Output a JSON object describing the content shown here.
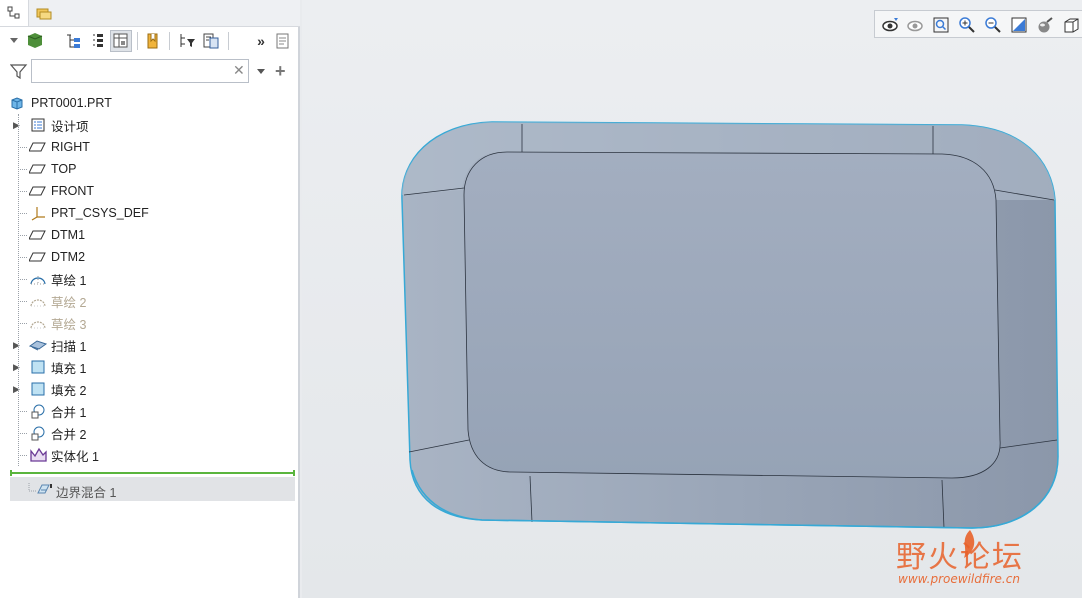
{
  "tree": {
    "root": "PRT0001.PRT",
    "items": [
      {
        "label": "设计项",
        "icon": "layers-icon",
        "expandable": true,
        "dim": false
      },
      {
        "label": "RIGHT",
        "icon": "datum-plane-icon",
        "expandable": false,
        "dim": false
      },
      {
        "label": "TOP",
        "icon": "datum-plane-icon",
        "expandable": false,
        "dim": false
      },
      {
        "label": "FRONT",
        "icon": "datum-plane-icon",
        "expandable": false,
        "dim": false
      },
      {
        "label": "PRT_CSYS_DEF",
        "icon": "csys-icon",
        "expandable": false,
        "dim": false
      },
      {
        "label": "DTM1",
        "icon": "datum-plane-icon",
        "expandable": false,
        "dim": false
      },
      {
        "label": "DTM2",
        "icon": "datum-plane-icon",
        "expandable": false,
        "dim": false
      },
      {
        "label": "草绘 1",
        "icon": "sketch-icon",
        "expandable": false,
        "dim": false
      },
      {
        "label": "草绘 2",
        "icon": "sketch-icon",
        "expandable": false,
        "dim": true
      },
      {
        "label": "草绘 3",
        "icon": "sketch-icon",
        "expandable": false,
        "dim": true
      },
      {
        "label": "扫描 1",
        "icon": "sweep-icon",
        "expandable": true,
        "dim": false
      },
      {
        "label": "填充 1",
        "icon": "fill-icon",
        "expandable": true,
        "dim": false
      },
      {
        "label": "填充 2",
        "icon": "fill-icon",
        "expandable": true,
        "dim": false
      },
      {
        "label": "合并 1",
        "icon": "merge-icon",
        "expandable": false,
        "dim": false
      },
      {
        "label": "合并 2",
        "icon": "merge-icon",
        "expandable": false,
        "dim": false
      },
      {
        "label": "实体化 1",
        "icon": "solidify-icon",
        "expandable": false,
        "dim": false
      }
    ],
    "suppressed": "边界混合 1"
  },
  "filter": {
    "value": "",
    "placeholder": ""
  },
  "watermark": {
    "title": "野火论坛",
    "url": "www.proewildfire.cn"
  },
  "colors": {
    "model": "#9aa8bb",
    "selection_edge": "#37a9d6",
    "insert_marker": "#5ab53d",
    "dim_text": "#b3a893"
  }
}
